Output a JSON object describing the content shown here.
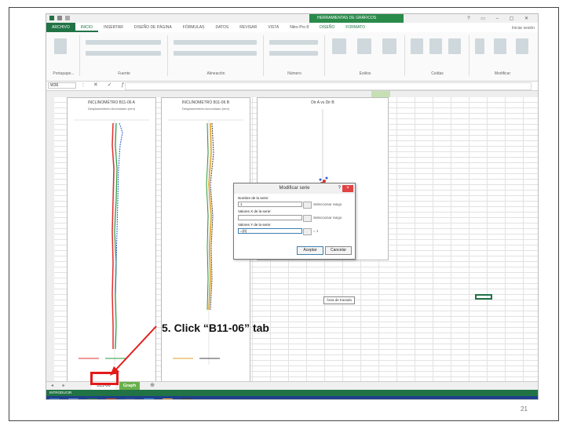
{
  "slide": {
    "callout": "5. Click “B11-06” tab",
    "page_number": "21"
  },
  "excel": {
    "ribbon_tabs": [
      "ARCHIVO",
      "INICIO",
      "INSERTAR",
      "DISEÑO DE PÁGINA",
      "FÓRMULAS",
      "DATOS",
      "REVISAR",
      "VISTA",
      "Nitro Pro 8",
      "DISEÑO",
      "FORMATO"
    ],
    "chart_tools_label": "HERRAMIENTAS DE GRÁFICOS",
    "sign_in": "Iniciar sesión",
    "group_labels": [
      "Portapape...",
      "Fuente",
      "Alineación",
      "Número",
      "Estilos",
      "Celdas",
      "Modificar"
    ],
    "name_box": "W36",
    "chart1": {
      "title": "INCLINOMETRO B11-06 A",
      "subtitle": "Desplazamiento Acumulado (mm)"
    },
    "chart2": {
      "title": "INCLINOMETRO B11-06 B",
      "subtitle": "Desplazamiento Acumulado (mm)"
    },
    "chart3": {
      "title": "Dir A vs Dir B"
    },
    "plot_area_tip": "Área de trazado",
    "sheet_tabs": {
      "b1106": "B11-06",
      "graph": "Graph"
    },
    "status": "INTRODUCIR"
  },
  "dialog": {
    "title": "Modificar serie",
    "help": "?",
    "close": "×",
    "name_label": "Nombre de la serie:",
    "name_value": "1",
    "x_label": "Valores X de la serie:",
    "x_value": "",
    "y_label": "Valores Y de la serie:",
    "y_value": "={0}",
    "select_range": "Seleccionar rango",
    "select_range_2": "Seleccionar rango",
    "y_result": "= 1",
    "ok": "Aceptar",
    "cancel": "Cancelar"
  },
  "colors": {
    "excel_green": "#217346",
    "highlight_red": "#e31a1a",
    "taskbar": "#1f3f8c"
  }
}
